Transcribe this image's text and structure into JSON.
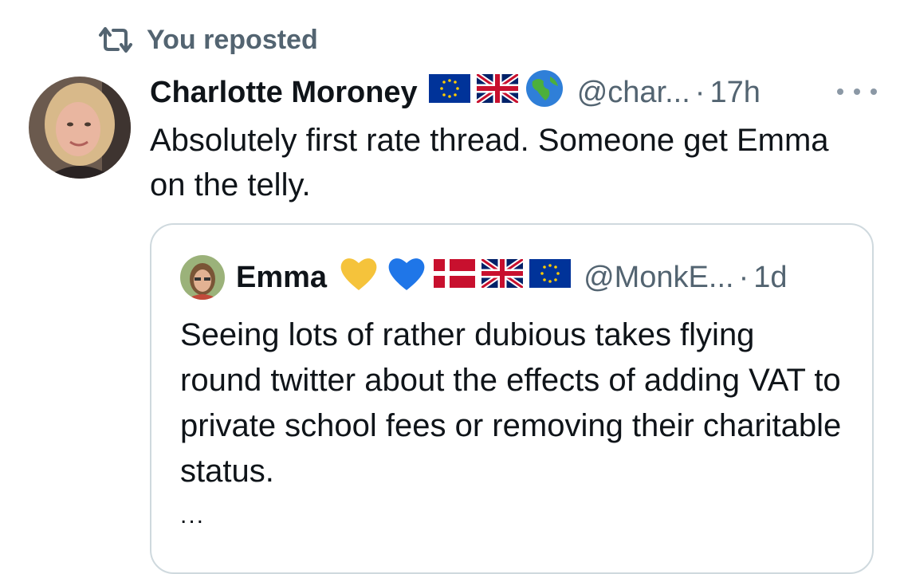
{
  "repost": {
    "label": "You reposted",
    "icon": "repost-icon"
  },
  "tweet": {
    "author_name": "Charlotte Moroney",
    "flags": [
      "eu-flag-icon",
      "uk-flag-icon",
      "globe-icon"
    ],
    "handle": "@char...",
    "separator": "·",
    "time": "17h",
    "text": "Absolutely first rate thread. Someone get Emma on the telly."
  },
  "quoted": {
    "author_name": "Emma",
    "icons": [
      "yellow-heart-icon",
      "blue-heart-icon",
      "denmark-flag-icon",
      "uk-flag-icon",
      "eu-flag-icon"
    ],
    "handle": "@MonkE...",
    "separator": "·",
    "time": "1d",
    "text": "Seeing lots of rather dubious takes flying round twitter about the effects of adding VAT to private school fees or removing their charitable status.",
    "more": "..."
  },
  "colors": {
    "text_primary": "#0f1419",
    "text_secondary": "#536471",
    "border": "#cfd9de",
    "eu_blue": "#003399",
    "eu_gold": "#ffcc00"
  }
}
